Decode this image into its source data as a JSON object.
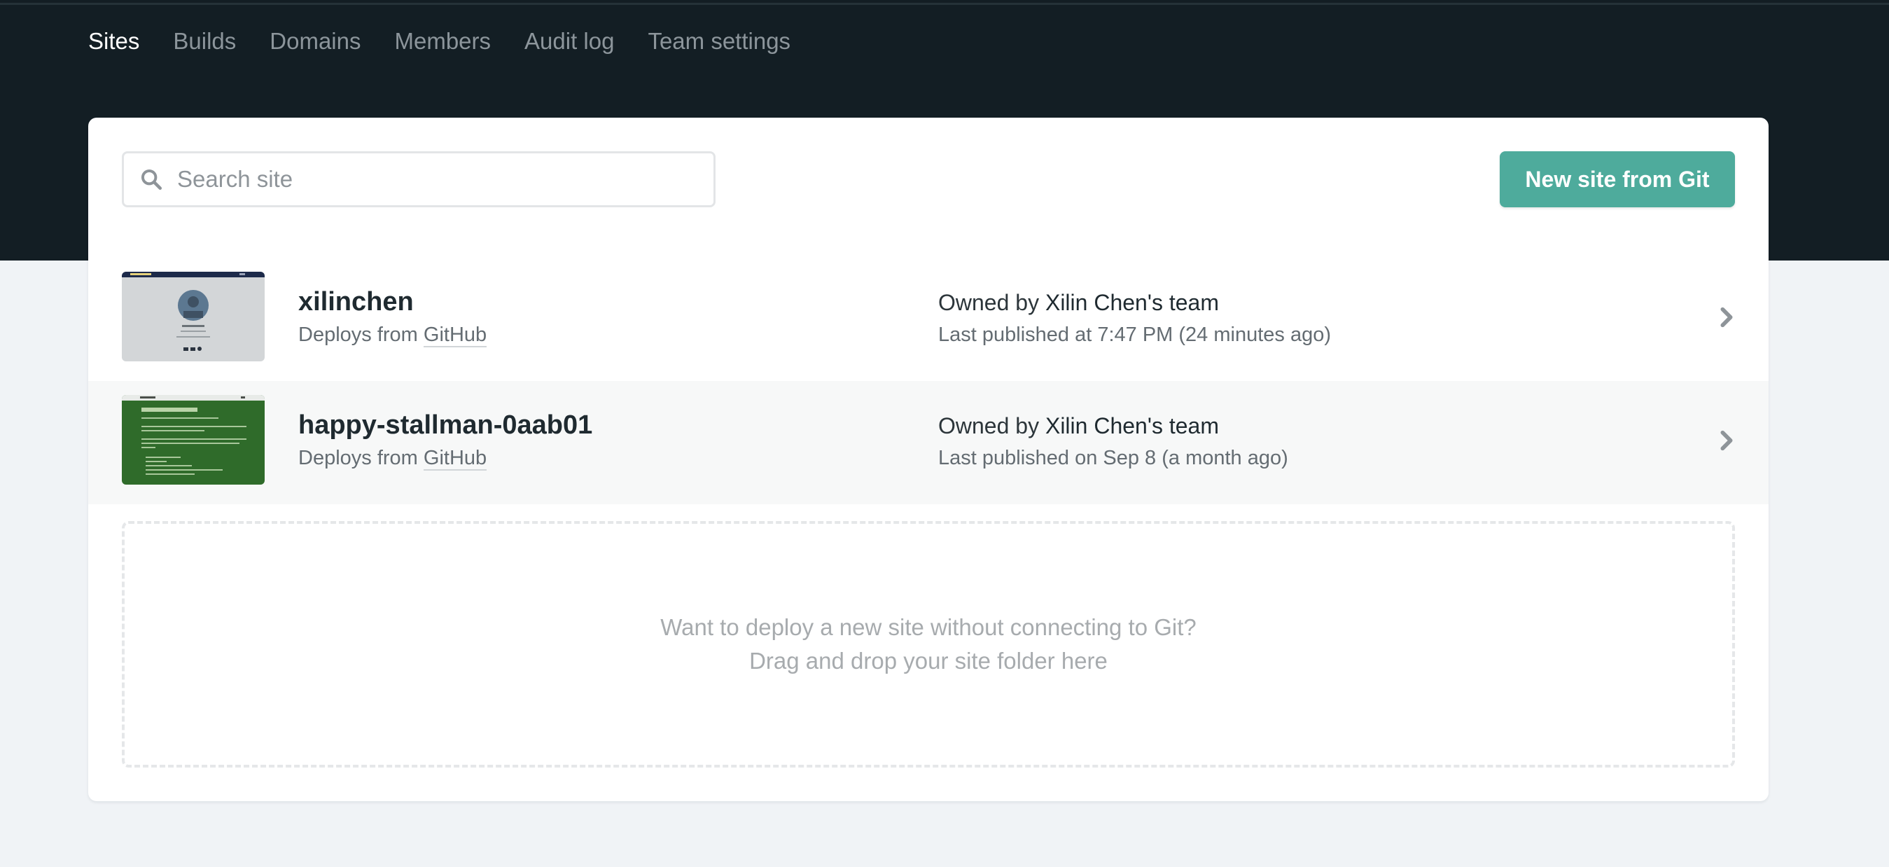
{
  "nav": {
    "tabs": [
      {
        "label": "Sites",
        "active": true
      },
      {
        "label": "Builds",
        "active": false
      },
      {
        "label": "Domains",
        "active": false
      },
      {
        "label": "Members",
        "active": false
      },
      {
        "label": "Audit log",
        "active": false
      },
      {
        "label": "Team settings",
        "active": false
      }
    ]
  },
  "search": {
    "placeholder": "Search site",
    "value": "",
    "icon": "search-icon"
  },
  "new_site_button": {
    "label": "New site from Git"
  },
  "sites": [
    {
      "name": "xilinchen",
      "deploys_prefix": "Deploys from",
      "provider": "GitHub",
      "owner_prefix": "Owned by",
      "owner": "Xilin Chen's team",
      "published": "Last published at 7:47 PM (24 minutes ago)",
      "thumbnail": {
        "header_text": "Xilin Chen",
        "name_text": "Xilin Chen",
        "style": "profile"
      }
    },
    {
      "name": "happy-stallman-0aab01",
      "deploys_prefix": "Deploys from",
      "provider": "GitHub",
      "owner_prefix": "Owned by",
      "owner": "Xilin Chen's team",
      "published": "Last published on Sep 8 (a month ago)",
      "thumbnail": {
        "header_text": "Academic",
        "name_text": "Academic Kickstart",
        "style": "academic"
      }
    }
  ],
  "dropzone": {
    "line1": "Want to deploy a new site without connecting to Git?",
    "line2": "Drag and drop your site folder here"
  },
  "colors": {
    "header_bg": "#131e24",
    "page_bg": "#f0f3f6",
    "accent": "#4eab9c",
    "thumbnail_profile_bg": "#d3d6d8",
    "thumbnail_academic_bg": "#2f6b2a"
  }
}
